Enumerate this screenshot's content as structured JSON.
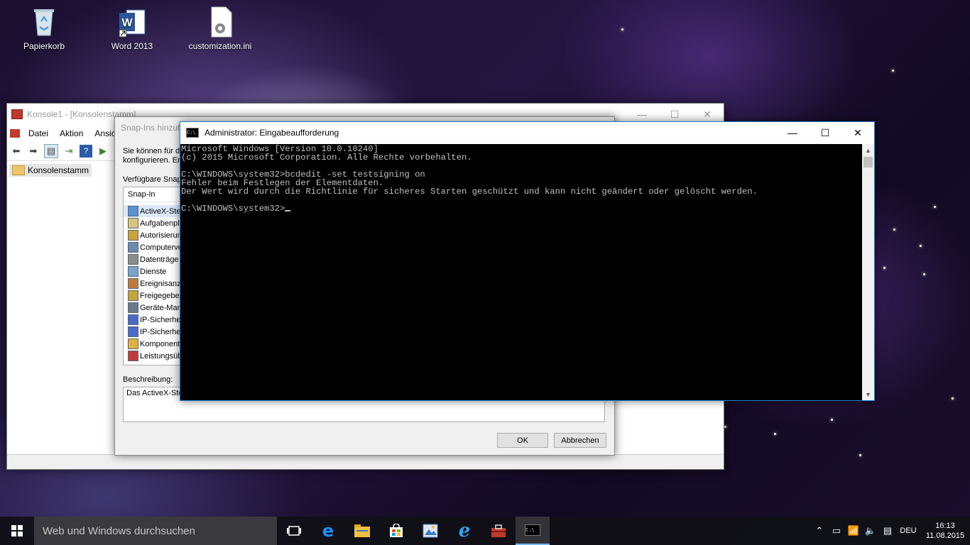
{
  "desktop": {
    "icons": [
      {
        "label": "Papierkorb"
      },
      {
        "label": "Word 2013"
      },
      {
        "label": "customization.ini"
      }
    ]
  },
  "mmc": {
    "title": "Konsole1 - [Konsolenstamm]",
    "menu": [
      "Datei",
      "Aktion",
      "Ansich"
    ],
    "tree_root": "Konsolenstamm"
  },
  "snapin": {
    "title": "Snap-Ins hinzuf",
    "description_intro": "Sie können für d konfigurieren. Er",
    "available_label": "Verfügbare Snap",
    "column_header": "Snap-In",
    "items": [
      "ActiveX-Ste",
      "Aufgabenpl",
      "Autorisierun",
      "Computerve",
      "Datenträge",
      "Dienste",
      "Ereignisanze",
      "Freigegeben",
      "Geräte-Man",
      "IP-Sicherhe",
      "IP-Sicherhe",
      "Komponente",
      "Leistungsüb"
    ],
    "description_label": "Beschreibung:",
    "description_text": "Das ActiveX-Ste enthält, hinzuzufügen.",
    "ok_label": "OK",
    "cancel_label": "Abbrechen"
  },
  "cmd": {
    "title": "Administrator: Eingabeaufforderung",
    "lines": [
      "Microsoft Windows [Version 10.0.10240]",
      "(c) 2015 Microsoft Corporation. Alle Rechte vorbehalten.",
      "",
      "C:\\WINDOWS\\system32>bcdedit -set testsigning on",
      "Fehler beim Festlegen der Elementdaten.",
      "Der Wert wird durch die Richtlinie für sicheres Starten geschützt und kann nicht geändert oder gelöscht werden.",
      "",
      "C:\\WINDOWS\\system32>"
    ]
  },
  "taskbar": {
    "search_placeholder": "Web und Windows durchsuchen",
    "apps": [
      "task-view",
      "edge",
      "file-explorer",
      "store",
      "photos",
      "internet-explorer",
      "toolbox",
      "cmd"
    ],
    "language": "DEU",
    "time": "16:13",
    "date": "11.08.2015"
  }
}
